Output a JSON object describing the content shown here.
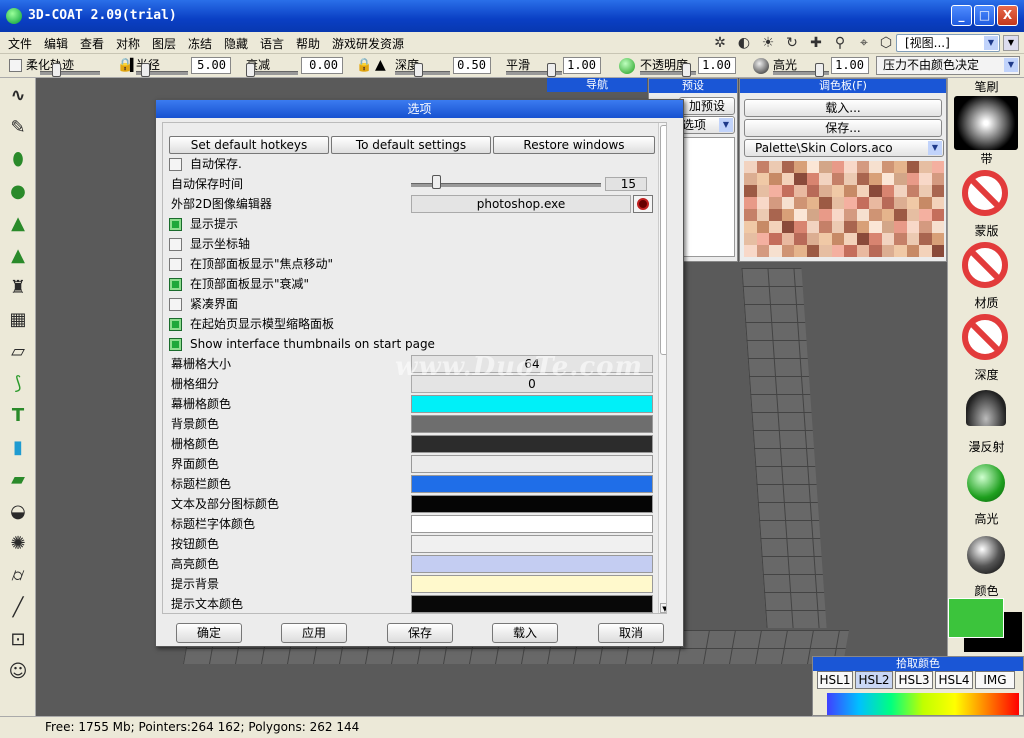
{
  "window": {
    "title": "3D-COAT 2.09(trial)",
    "btn_min": "_",
    "btn_max": "□",
    "btn_close": "X"
  },
  "menu": {
    "items": [
      "文件",
      "编辑",
      "查看",
      "对称",
      "图层",
      "冻结",
      "隐藏",
      "语言",
      "帮助",
      "游戏研发资源"
    ],
    "view_select": "[视图...]"
  },
  "toolbar": {
    "soft_stroke": "柔化轨迹",
    "radius_label": "半径",
    "radius_value": "5.00",
    "falloff_label": "衰减",
    "falloff_value": "0.00",
    "depth_label": "深度",
    "depth_value": "0.50",
    "smooth_label": "平滑",
    "smooth_value": "1.00",
    "opacity_label": "不透明度",
    "opacity_value": "1.00",
    "specular_label": "高光",
    "specular_value": "1.00",
    "pressure_select": "压力不由颜色决定"
  },
  "panels": {
    "nav": "导航",
    "presets": "预设",
    "add_preset": "加预设",
    "options": "选项",
    "palette_title": "调色板(F)",
    "load_btn": "载入...",
    "save_btn": "保存...",
    "palette_file": "Palette\\Skin Colors.aco"
  },
  "right_column": {
    "brush": "笔刷",
    "strip": "带",
    "mask": "蒙版",
    "material": "材质",
    "depth": "深度",
    "diffuse": "漫反射",
    "specular": "高光",
    "color": "颜色"
  },
  "dialog": {
    "title": "选项",
    "btn_hotkeys": "Set default hotkeys",
    "btn_defaults": "To default settings",
    "btn_restore": "Restore windows",
    "autosave": "自动保存.",
    "autosave_time_label": "自动保存时间",
    "autosave_time_value": "15",
    "autosave_time_fraction": 0.13,
    "ext_editor_label": "外部2D图像编辑器",
    "ext_editor_value": "photoshop.exe",
    "show_hints": "显示提示",
    "show_axes": "显示坐标轴",
    "show_focus_move": "在顶部面板显示\"焦点移动\"",
    "show_falloff": "在顶部面板显示\"衰减\"",
    "compact_ui": "紧凑界面",
    "show_thumbs_cn": "在起始页显示模型缩略面板",
    "show_thumbs_en": "Show interface thumbnails on start page",
    "grid_size_label": "幕栅格大小",
    "grid_size_value": "64",
    "grid_subdiv_label": "栅格细分",
    "grid_subdiv_value": "0",
    "screen_grid_color": "幕栅格颜色",
    "bg_color": "背景颜色",
    "grid_color": "栅格颜色",
    "ui_color": "界面颜色",
    "titlebar_color": "标题栏颜色",
    "text_icon_color": "文本及部分图标颜色",
    "title_text_color": "标题栏字体颜色",
    "button_color": "按钮颜色",
    "highlight_color": "高亮颜色",
    "hint_bg": "提示背景",
    "hint_text_color": "提示文本颜色",
    "ok": "确定",
    "apply": "应用",
    "save": "保存",
    "load": "载入",
    "cancel": "取消",
    "colors": {
      "screen_grid": "#00f0f8",
      "bg": "#6e6e6e",
      "grid": "#2c2c2c",
      "ui": "#ececec",
      "titlebar": "#1f6ee8",
      "text_icon": "#050505",
      "title_text": "#ffffff",
      "button": "#f0f0f0",
      "highlight": "#c4cdf2",
      "hint_bg": "#fff9cc",
      "hint_text": "#080808"
    }
  },
  "watermark": "www.DuoTe.com",
  "colorpick": {
    "title": "拾取颜色",
    "tabs": [
      "HSL1",
      "HSL2",
      "HSL3",
      "HSL4",
      "IMG"
    ]
  },
  "status": {
    "text": "Free: 1755 Mb; Pointers:264 162; Polygons: 262 144"
  },
  "accent": {
    "window_blue": "#0a3fc4",
    "current_color": "#3cc43c"
  }
}
